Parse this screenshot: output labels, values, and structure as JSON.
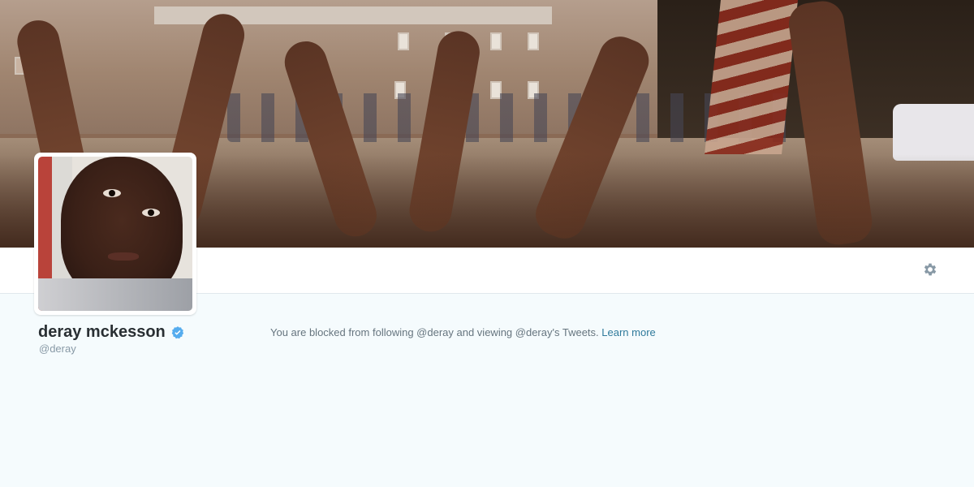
{
  "profile": {
    "name": "deray mckesson",
    "handle": "@deray",
    "verified": true
  },
  "blocked_notice": {
    "message": "You are blocked from following @deray and viewing @deray's Tweets.",
    "learn_more_label": "Learn more"
  },
  "icons": {
    "settings": "gear-icon",
    "verified": "verified-badge-icon"
  },
  "colors": {
    "page_background": "#f5fbfd",
    "accent_link": "#2f7a9b",
    "verified_blue": "#55acee",
    "name_text": "#292f33",
    "muted_text": "#8899a6"
  }
}
